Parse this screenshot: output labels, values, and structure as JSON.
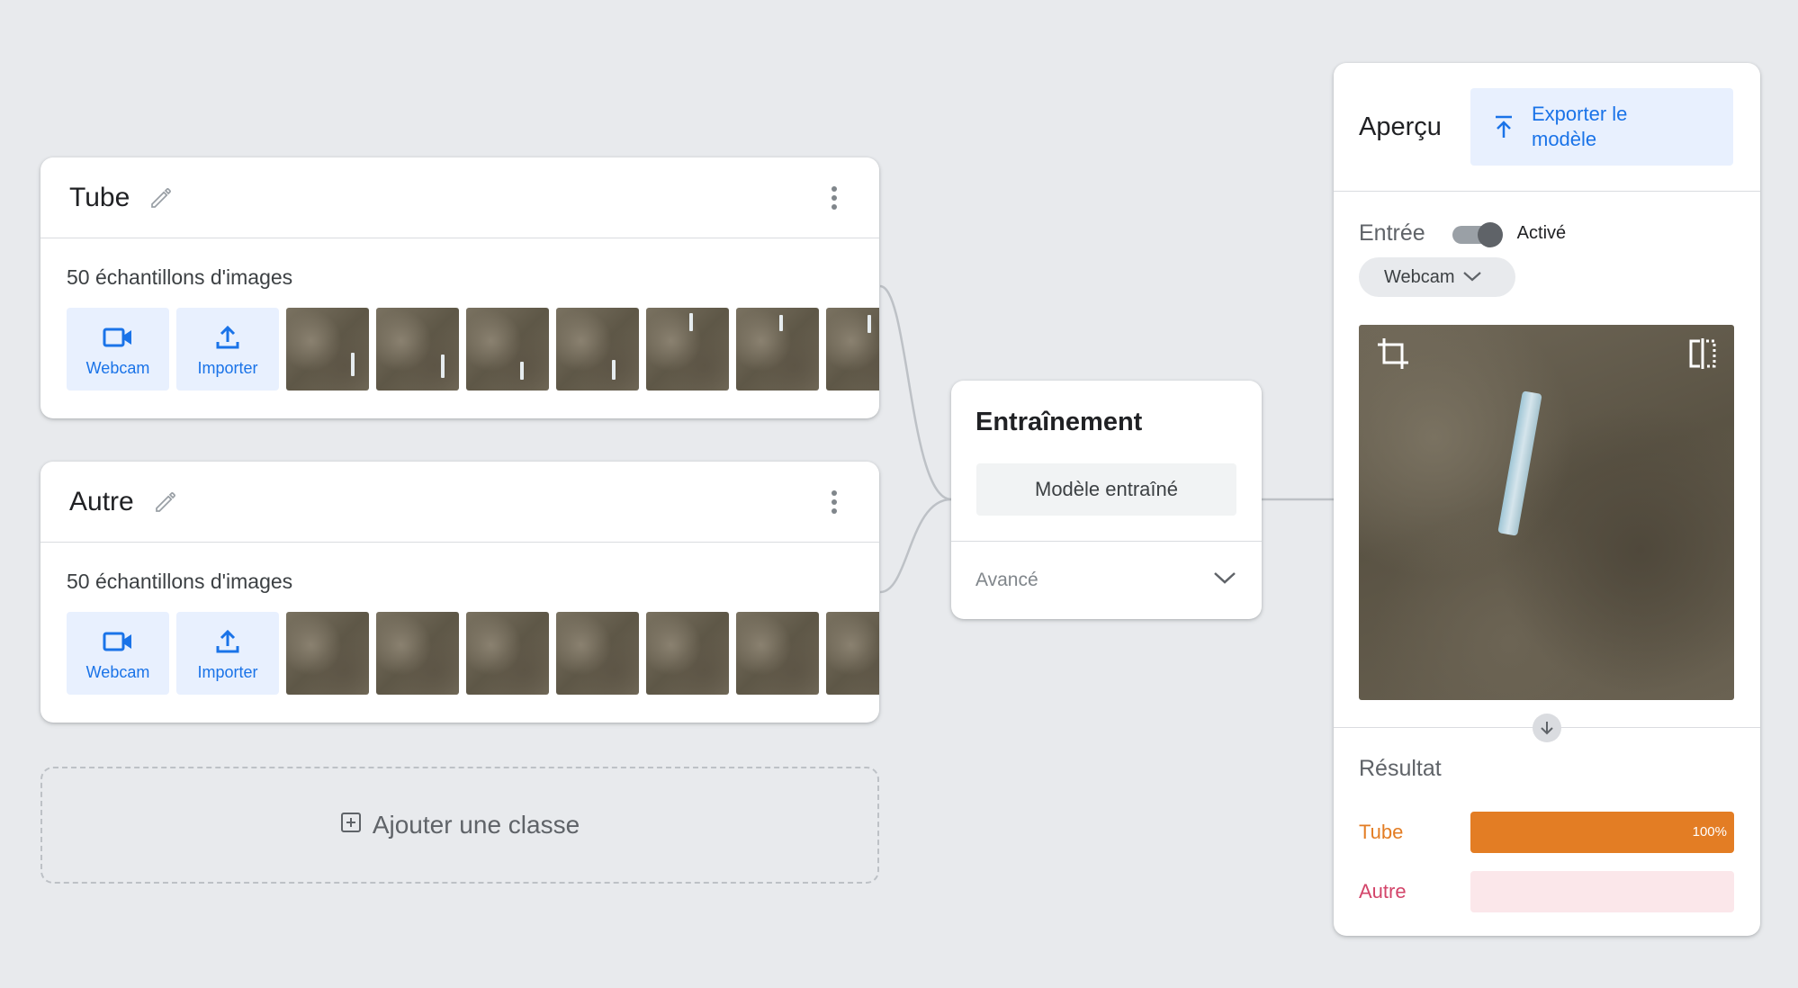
{
  "classes": [
    {
      "name": "Tube",
      "count_label": "50 échantillons d'images",
      "webcam_label": "Webcam",
      "import_label": "Importer",
      "thumbnails": 7
    },
    {
      "name": "Autre",
      "count_label": "50 échantillons d'images",
      "webcam_label": "Webcam",
      "import_label": "Importer",
      "thumbnails": 7
    }
  ],
  "add_class": {
    "label": "Ajouter une classe"
  },
  "training": {
    "title": "Entraînement",
    "button_label": "Modèle entraîné",
    "advanced_label": "Avancé"
  },
  "preview": {
    "title": "Aperçu",
    "export_label_line1": "Exporter le",
    "export_label_line2": "modèle",
    "input_label": "Entrée",
    "toggle_state": "Activé",
    "toggle_on": true,
    "source": "Webcam",
    "result_title": "Résultat",
    "results": [
      {
        "label": "Tube",
        "percent": 100,
        "percent_label": "100%",
        "color": "#e37d24",
        "track": "#fce8d4"
      },
      {
        "label": "Autre",
        "percent": 0,
        "percent_label": "",
        "color": "#d3456a",
        "track": "#fbe7ea"
      }
    ]
  },
  "colors": {
    "background": "#e8eaed",
    "accent_blue": "#1a73e8",
    "accent_blue_light": "#e8f0fe"
  }
}
